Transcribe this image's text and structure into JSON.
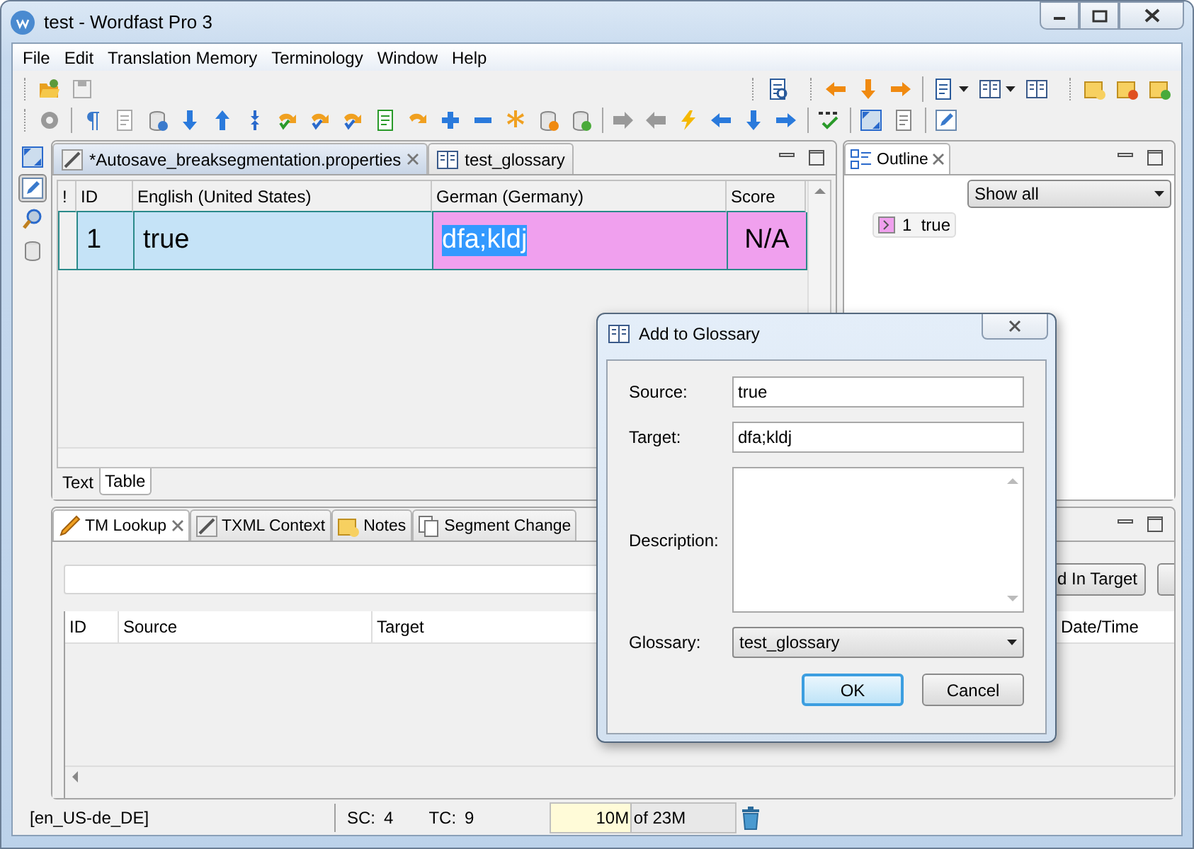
{
  "window": {
    "title": "test - Wordfast Pro 3"
  },
  "menu": [
    {
      "label": "File"
    },
    {
      "label": "Edit"
    },
    {
      "label": "Translation Memory"
    },
    {
      "label": "Terminology"
    },
    {
      "label": "Window"
    },
    {
      "label": "Help"
    }
  ],
  "editor": {
    "tabs": [
      {
        "label": "*Autosave_breaksegmentation.properties",
        "selected": true
      },
      {
        "label": "test_glossary",
        "selected": false
      }
    ],
    "columns": [
      "!",
      "ID",
      "English (United States)",
      "German (Germany)",
      "Score"
    ],
    "rows": [
      {
        "id": "1",
        "source": "true",
        "target": "dfa;kldj",
        "score": "N/A",
        "selected": true,
        "target_text_selected": true
      }
    ],
    "view_tabs": [
      {
        "label": "Text",
        "selected": false
      },
      {
        "label": "Table",
        "selected": true
      }
    ]
  },
  "outline": {
    "title": "Outline",
    "filter": "Show all",
    "items": [
      {
        "id": "1",
        "text": "true"
      }
    ]
  },
  "bottom": {
    "tabs": [
      {
        "label": "TM Lookup",
        "selected": true
      },
      {
        "label": "TXML Context",
        "selected": false
      },
      {
        "label": "Notes",
        "selected": false
      },
      {
        "label": "Segment Change",
        "selected": false
      }
    ],
    "button": "d In Target",
    "columns": [
      "ID",
      "Source",
      "Target",
      "Date/Time"
    ]
  },
  "status": {
    "locale": "[en_US-de_DE]",
    "sc_label": "SC:",
    "sc": "4",
    "tc_label": "TC:",
    "tc": "9",
    "memory": "10M of 23M",
    "level": 0.43
  },
  "dialog": {
    "title": "Add to Glossary",
    "fields": [
      {
        "kind": "text",
        "label": "Source:",
        "value": "true"
      },
      {
        "kind": "text",
        "label": "Target:",
        "value": "dfa;kldj"
      },
      {
        "kind": "textarea",
        "label": "Description:"
      },
      {
        "kind": "select",
        "label": "Glossary:",
        "value": "test_glossary"
      }
    ],
    "buttons": [
      {
        "label": "OK",
        "default": true
      },
      {
        "label": "Cancel",
        "default": false
      }
    ]
  }
}
